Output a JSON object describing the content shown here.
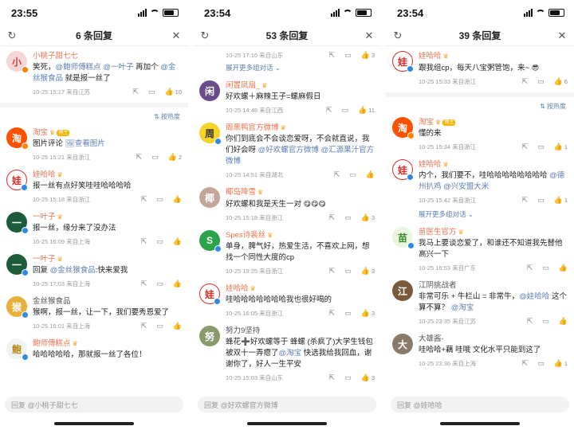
{
  "panels": [
    {
      "time": "23:55",
      "title": "6 条回复",
      "sort_label": "按热度",
      "reply_placeholder": "回复 @小桃子甜七七",
      "root": {
        "user": "小桃子甜七七",
        "text_plain": "笑死，",
        "mention1": "@鲍师傅糕点",
        "mention2": "@一叶子",
        "text_mid": " 再加个 ",
        "mention3": "@金丝猴食品",
        "text_end": " 就是报一丝了",
        "time": "10-25 15:17 来自江苏",
        "likes": "10"
      },
      "comments": [
        {
          "user": "淘宝",
          "text": "图片评论 ",
          "link": "查看图片",
          "time": "10-25 15:21 来自浙江",
          "likes": "2",
          "avatar_color": "#ff5000",
          "avatar_char": "淘"
        },
        {
          "user": "娃哈哈",
          "text": "报一丝有点好笑哇哇哈哈哈哈",
          "time": "10-25 15:18 来自浙江",
          "likes": "",
          "avatar_color": "#d9302c",
          "avatar_char": "娃"
        },
        {
          "user": "一叶子",
          "text": "报一丝，缘分来了没办法",
          "time": "10-25 16:09 来自上海",
          "likes": "",
          "avatar_color": "#1d5c3a",
          "avatar_char": "一"
        },
        {
          "user": "一叶子",
          "text": "回复 ",
          "link": "@金丝猴食品",
          "text2": ":快来爱我",
          "time": "10-25 17:03 来自上海",
          "likes": "",
          "avatar_color": "#1d5c3a",
          "avatar_char": "一"
        },
        {
          "user": "金丝猴食品",
          "text": "猴啊，报一丝，让一下，我们要秀恩爱了",
          "time": "10-25 16:01 来自上海",
          "likes": "",
          "avatar_color": "#e8b03a",
          "avatar_char": "猴"
        },
        {
          "user": "鲍师傅糕点",
          "text": "哈哈哈哈哈，那就报一丝了各位！",
          "time": "",
          "likes": "",
          "avatar_color": "#f2f2f2",
          "avatar_char": "鲍"
        }
      ]
    },
    {
      "time": "23:54",
      "title": "53 条回复",
      "reply_placeholder": "回复 @好欢螺官方微博",
      "top_meta": "10-25 17:10 来自山东",
      "top_likes": "3",
      "expand_label": "展开更多组对话",
      "comments": [
        {
          "user": "闲置凤扇_",
          "text": "好欢螺＋麻辣王子=螺麻假日",
          "time": "10-25 14:48 来自江西",
          "likes": "11",
          "avatar_color": "#6b4c8a",
          "avatar_char": "闲"
        },
        {
          "user": "周黑鸭官方微博",
          "text": "你们到底会不会谈恋爱呀，不会就直说，我们好会呀",
          "link": "@好欢螺官方微博",
          "link2": "@汇源果汁官方微博",
          "time": "10-25 14:51 来自湖北",
          "likes": "",
          "avatar_color": "#f5d327",
          "avatar_char": "周"
        },
        {
          "user": "椰岛降雪",
          "text": "好欢螺和我是天生一对",
          "time": "10-25 15:18 来自浙江",
          "likes": "3",
          "avatar_color": "#c4a59a",
          "avatar_char": "椰"
        },
        {
          "user": "Spes诗裴丝",
          "text": "单身，脾气好，热爱生活，不喜欢上网，想找一个同性大度的cp",
          "time": "10-25 19:25 来自浙江",
          "likes": "3",
          "avatar_color": "#2aa34a",
          "avatar_char": "S"
        },
        {
          "user": "娃哈哈",
          "text": "哇哈哈哈哈哈哈哈我也很好喝的",
          "time": "10-25 16:05 来自浙江",
          "likes": "3",
          "avatar_color": "#d9302c",
          "avatar_char": "娃"
        },
        {
          "user": "努力9坚持",
          "text": "蜂花➕好欢螺等于 蜂螺 (杀疯了)大学生钱包被双十一弄瘪了",
          "link": "@淘宝",
          "text2": " 快选我给我回血，谢谢你了，好人一生平安",
          "time": "10-25 15:03 来自山东",
          "likes": "3",
          "avatar_color": "#8a9a6a",
          "avatar_char": "努"
        }
      ]
    },
    {
      "time": "23:54",
      "title": "39 条回复",
      "sort_label": "按热度",
      "reply_placeholder": "回复 @娃哈哈",
      "expand_label": "展开更多组对话",
      "root": {
        "user": "娃哈哈",
        "text": "跟我组cp，每天八宝粥管饱，来~",
        "time": "10-25 15:33 来自浙江",
        "likes": "6"
      },
      "comments": [
        {
          "user": "淘宝",
          "text": "懂的来",
          "time": "10-25 15:34 来自浙江",
          "likes": "1",
          "avatar_color": "#ff5000",
          "avatar_char": "淘"
        },
        {
          "user": "娃哈哈",
          "text": "内个，我们要不，哇哈哈哈哈哈哈哈哈 ",
          "link": "@德州扒鸡",
          "link2": "@兴安盟大米",
          "time": "10-25 15:42 来自浙江",
          "likes": "1",
          "avatar_color": "#d9302c",
          "avatar_char": "娃"
        },
        {
          "user": "苗医生官方",
          "text": "我马上要谈恋爱了，和谁还不知道我先替他高兴一下",
          "time": "10-25 16:53 来自广东",
          "likes": "",
          "avatar_color": "#9bd46a",
          "avatar_char": "苗"
        },
        {
          "user": "江阴挑战者",
          "text": "非常可乐 + 牛栏山 = 非常牛，",
          "link": "@娃哈哈",
          "text2": " 这个算不算？",
          "link2": "@淘宝",
          "time": "10-25 23:35 来自江苏",
          "likes": "",
          "avatar_color": "#7a5a3a",
          "avatar_char": "江"
        },
        {
          "user": "大雄酱-",
          "text": "哇哈哈+藕 哇哦 文化水平只能到这了",
          "time": "10-25 23:36 来自上海",
          "likes": "1",
          "avatar_color": "#8a7a6a",
          "avatar_char": "大"
        }
      ]
    }
  ]
}
